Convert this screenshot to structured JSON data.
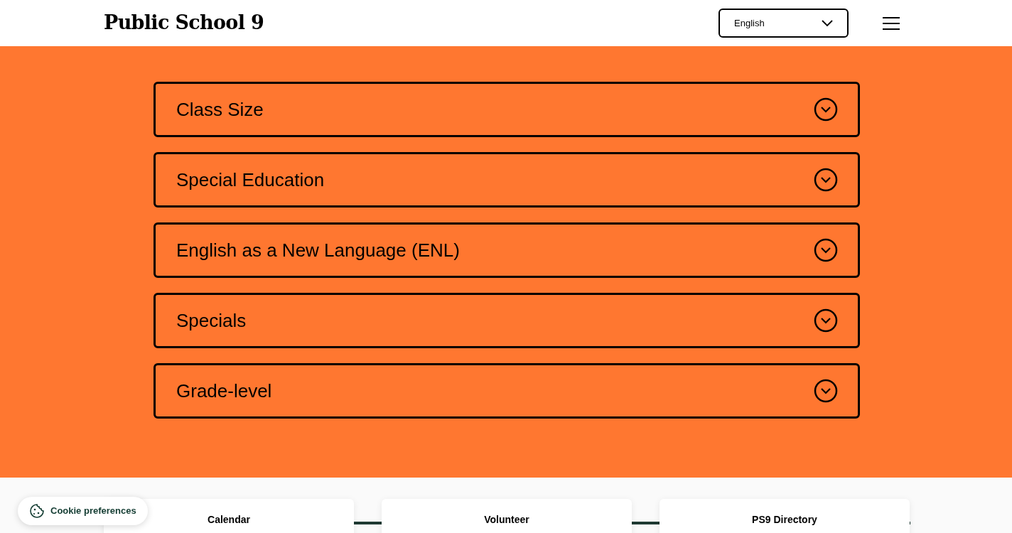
{
  "header": {
    "logo": "Public School 9",
    "language_select": {
      "value": "English"
    }
  },
  "faq": {
    "items": [
      {
        "question": "Class Size",
        "expanded": false
      },
      {
        "question": "Special Education",
        "expanded": false
      },
      {
        "question": "English as a New Language (ENL)",
        "expanded": false
      },
      {
        "question": "Specials",
        "expanded": false
      },
      {
        "question": "Grade-level",
        "expanded": false
      }
    ]
  },
  "cards": [
    {
      "title": "Calendar"
    },
    {
      "title": "Volunteer"
    },
    {
      "title": "PS9 Directory"
    }
  ],
  "cookie_button": {
    "label": "Cookie preferences"
  }
}
